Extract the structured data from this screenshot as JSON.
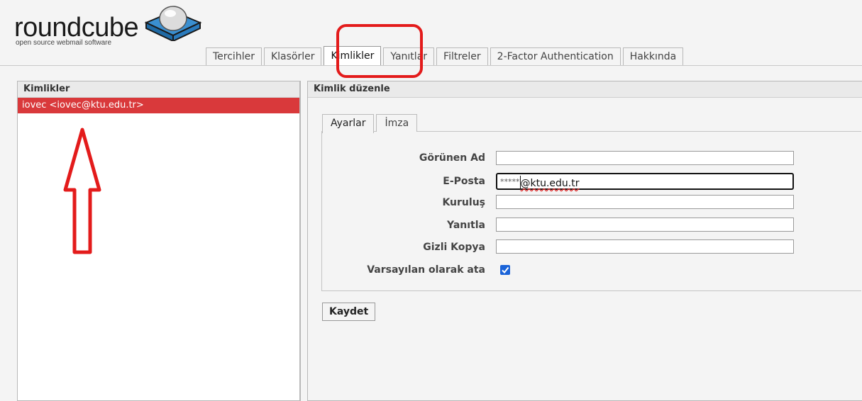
{
  "header": {
    "logo_word": "roundcube",
    "logo_tagline": "open source webmail software"
  },
  "tabs": [
    {
      "label": "Tercihler"
    },
    {
      "label": "Klasörler"
    },
    {
      "label": "Kimlikler",
      "selected": true
    },
    {
      "label": "Yanıtlar"
    },
    {
      "label": "Filtreler"
    },
    {
      "label": "2-Factor Authentication"
    },
    {
      "label": "Hakkında"
    }
  ],
  "identities_panel": {
    "title": "Kimlikler",
    "items": [
      {
        "label": "iovec <iovec@ktu.edu.tr>",
        "selected": true
      }
    ]
  },
  "edit_panel": {
    "title": "Kimlik düzenle",
    "sub_tabs": [
      {
        "label": "Ayarlar",
        "selected": true
      },
      {
        "label": "İmza"
      }
    ],
    "fields": {
      "display_name": {
        "label": "Görünen Ad",
        "value": ""
      },
      "email": {
        "label": "E-Posta",
        "value_mask": "*****",
        "value_domain": "@ktu.edu.tr"
      },
      "organization": {
        "label": "Kuruluş",
        "value": ""
      },
      "reply_to": {
        "label": "Yanıtla",
        "value": ""
      },
      "bcc": {
        "label": "Gizli Kopya",
        "value": ""
      },
      "default": {
        "label": "Varsayılan olarak ata",
        "checked": true
      }
    },
    "save_label": "Kaydet"
  },
  "colors": {
    "selection_red": "#d9393b",
    "annotation_red": "#e31b1b",
    "checkbox_blue": "#1a63d8"
  }
}
